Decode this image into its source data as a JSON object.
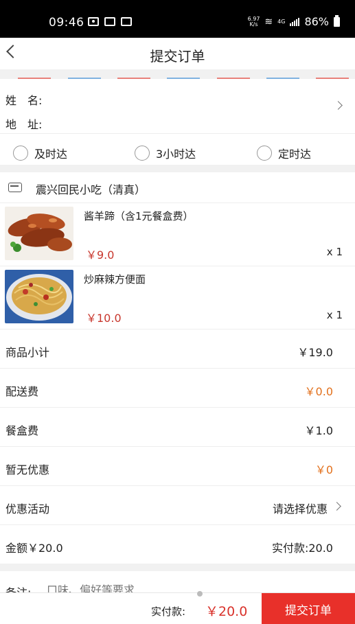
{
  "status_bar": {
    "time": "09:46",
    "speed_value": "6.97",
    "speed_unit": "K/s",
    "net_type": "4G",
    "battery": "86%"
  },
  "header": {
    "title": "提交订单",
    "back_icon": "chevron-left-icon"
  },
  "address": {
    "name_label": "姓　名:",
    "address_label": "地　址:"
  },
  "delivery_options": [
    {
      "label": "及时达"
    },
    {
      "label": "3小时达"
    },
    {
      "label": "定时达"
    }
  ],
  "shop": {
    "name": "震兴回民小吃（清真）",
    "icon": "store-icon"
  },
  "items": [
    {
      "name": "酱羊蹄（含1元餐盒费）",
      "price": "￥9.0",
      "qty": "x 1",
      "image": "braised-lamb-trotters-photo"
    },
    {
      "name": "炒麻辣方便面",
      "price": "￥10.0",
      "qty": "x 1",
      "image": "spicy-fried-noodles-photo"
    }
  ],
  "summary": {
    "subtotal_label": "商品小计",
    "subtotal_value": "￥19.0",
    "delivery_fee_label": "配送费",
    "delivery_fee_value": "￥0.0",
    "box_fee_label": "餐盒费",
    "box_fee_value": "￥1.0",
    "discount_label": "暂无优惠",
    "discount_value": "￥0",
    "promo_label": "优惠活动",
    "promo_value": "请选择优惠",
    "total_label": "金额￥20.0",
    "actual_label": "实付款:20.0"
  },
  "remark": {
    "label": "备注:",
    "placeholder": "口味、偏好等要求"
  },
  "bottom_bar": {
    "pay_label": "实付款:",
    "pay_amount": "￥20.0",
    "submit_label": "提交订单"
  },
  "colors": {
    "accent_red": "#e8302a",
    "price_red": "#c8372d",
    "orange": "#e2701c"
  }
}
